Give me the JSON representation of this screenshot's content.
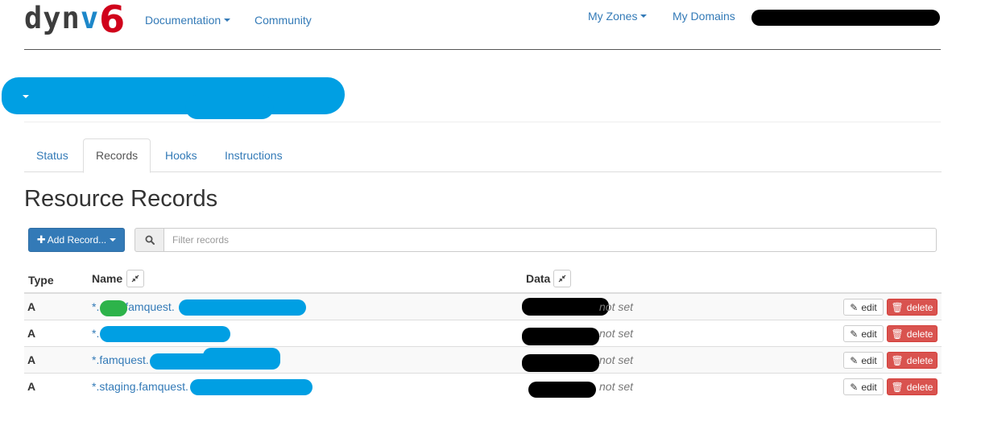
{
  "brand": {
    "part1": "dyn",
    "part2": "v",
    "part3": "6"
  },
  "nav": {
    "documentation": "Documentation",
    "community": "Community",
    "my_zones": "My Zones",
    "my_domains": "My Domains"
  },
  "tabs": [
    {
      "label": "Status",
      "active": false
    },
    {
      "label": "Records",
      "active": true
    },
    {
      "label": "Hooks",
      "active": false
    },
    {
      "label": "Instructions",
      "active": false
    }
  ],
  "section_title": "Resource Records",
  "toolbar": {
    "add_label": "Add Record...",
    "search_icon": "search-icon",
    "filter_placeholder": "Filter records"
  },
  "table": {
    "columns": {
      "type": "Type",
      "name": "Name",
      "data": "Data"
    },
    "rows": [
      {
        "type": "A",
        "name_prefix": "*.",
        "name_mid": ".famquest.",
        "data": "not set"
      },
      {
        "type": "A",
        "name_prefix": "*.",
        "name_mid": "",
        "data": "not set"
      },
      {
        "type": "A",
        "name_prefix": "*.famquest.",
        "name_mid": "",
        "data": "not set"
      },
      {
        "type": "A",
        "name_prefix": "*.staging.famquest.",
        "name_mid": "",
        "data": "not set"
      }
    ],
    "edit_label": "edit",
    "delete_label": "delete"
  },
  "colors": {
    "link": "#337ab7",
    "primary_button": "#337ab7",
    "danger_button": "#d9534f",
    "brand_dark": "#3d3d3d",
    "brand_blue": "#1d87c9",
    "brand_red": "#d0021b"
  }
}
